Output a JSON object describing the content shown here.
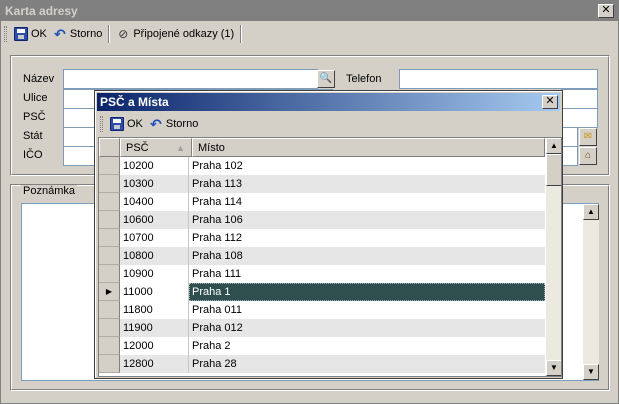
{
  "window": {
    "title": "Karta adresy",
    "close_glyph": "✕",
    "toolbar": {
      "ok_label": "OK",
      "storno_label": "Storno",
      "links_label": "Připojené odkazy (1)"
    },
    "form": {
      "nazev_label": "Název",
      "telefon_label": "Telefon",
      "ulice_label": "Ulice",
      "psc_label": "PSČ",
      "stat_label": "Stát",
      "ico_label": "IČO",
      "poznamka_label": "Poznámka"
    }
  },
  "dialog": {
    "title": "PSČ a Místa",
    "close_glyph": "✕",
    "toolbar": {
      "ok_label": "OK",
      "storno_label": "Storno"
    },
    "grid": {
      "columns": [
        "PSČ",
        "Místo"
      ],
      "rows": [
        {
          "psc": "10200",
          "misto": "Praha 102"
        },
        {
          "psc": "10300",
          "misto": "Praha 113"
        },
        {
          "psc": "10400",
          "misto": "Praha 114"
        },
        {
          "psc": "10600",
          "misto": "Praha 106"
        },
        {
          "psc": "10700",
          "misto": "Praha 112"
        },
        {
          "psc": "10800",
          "misto": "Praha 108"
        },
        {
          "psc": "10900",
          "misto": "Praha 111"
        },
        {
          "psc": "11000",
          "misto": "Praha 1"
        },
        {
          "psc": "11800",
          "misto": "Praha 011"
        },
        {
          "psc": "11900",
          "misto": "Praha 012"
        },
        {
          "psc": "12000",
          "misto": "Praha 2"
        },
        {
          "psc": "12800",
          "misto": "Praha 28"
        }
      ],
      "selected_index": 7,
      "selected_marker": "▶"
    }
  },
  "icons": {
    "ok": "floppy-disk-icon",
    "storno": "undo-arrow-icon",
    "links": "paperclip-icon",
    "search": "magnifier-icon",
    "mail": "envelope-icon",
    "house": "house-icon"
  }
}
